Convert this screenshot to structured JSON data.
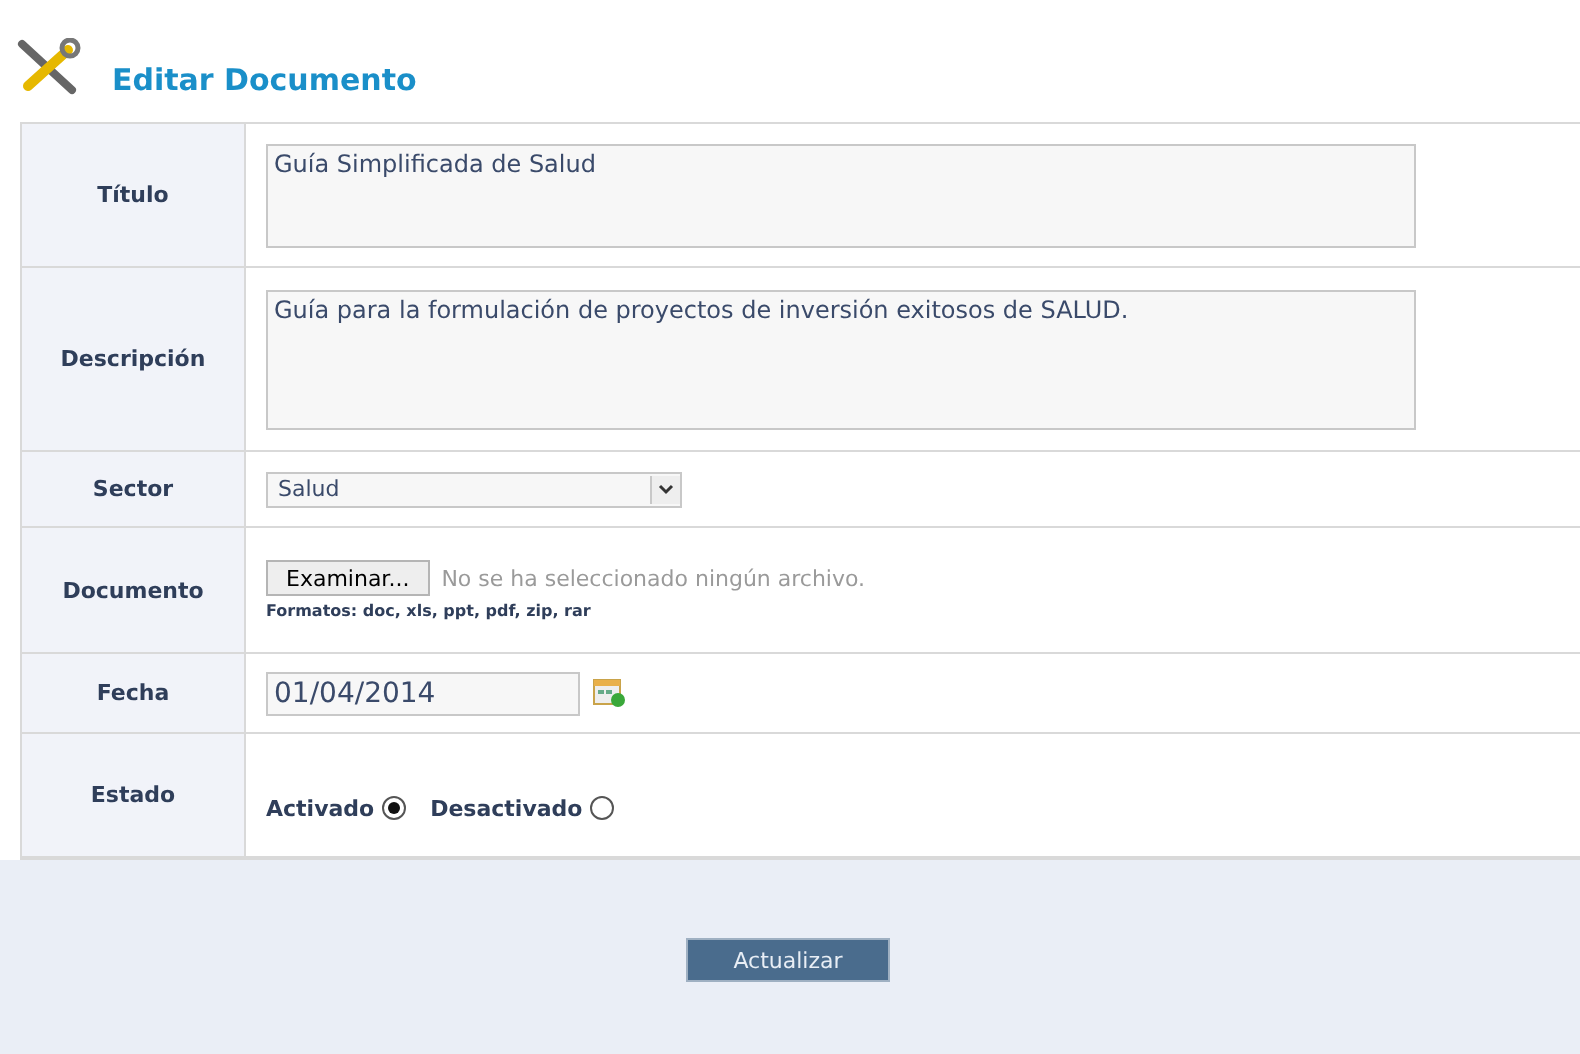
{
  "title": "Editar Documento",
  "fields": [
    {
      "kind": "textarea",
      "label": "Título",
      "value": "Guía Simplificada de Salud"
    },
    {
      "kind": "textarea",
      "label": "Descripción",
      "value": "Guía para la formulación de proyectos de inversión exitosos de SALUD."
    },
    {
      "kind": "select",
      "label": "Sector",
      "value": "Salud"
    },
    {
      "kind": "file",
      "label": "Documento",
      "button": "Examinar...",
      "status": "No se ha seleccionado ningún archivo.",
      "hint": "Formatos: doc, xls, ppt, pdf, zip, rar"
    },
    {
      "kind": "date",
      "label": "Fecha",
      "value": "01/04/2014"
    },
    {
      "kind": "radio",
      "label": "Estado",
      "options": [
        {
          "label": "Activado",
          "selected": true
        },
        {
          "label": "Desactivado",
          "selected": false
        }
      ]
    }
  ],
  "submit": "Actualizar"
}
